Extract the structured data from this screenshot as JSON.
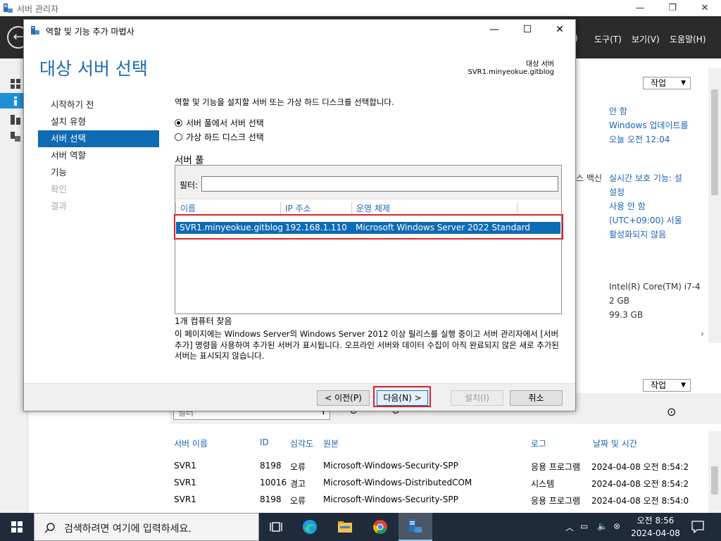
{
  "main_window": {
    "title": "서버 관리자",
    "controls": {
      "minimize": "—",
      "maximize": "❐",
      "close": "✕"
    },
    "menu": [
      {
        "id": "m1",
        "label": ")"
      },
      {
        "id": "m2",
        "label": "도구(T)"
      },
      {
        "id": "m3",
        "label": "보기(V)"
      },
      {
        "id": "m4",
        "label": "도움말(H)"
      }
    ],
    "back_glyph": "←"
  },
  "background": {
    "task_dropdown_1": "작업",
    "task_dropdown_2": "작업",
    "props": [
      "안 함",
      "Windows 업데이트를",
      "오늘 오전 12:04",
      "실시간 보호 기능: 설",
      "설정",
      "사용 안 함",
      "(UTC+09:00) 서울",
      "활성화되지 않음",
      "Intel(R) Core(TM) i7-4",
      "2 GB",
      "99.3 GB"
    ],
    "av_label": "스 백신",
    "search_fragment": "필터",
    "events": {
      "headers": [
        "서버 이름",
        "ID",
        "심각도",
        "원본",
        "로그",
        "날짜 및 시간"
      ],
      "rows": [
        [
          "SVR1",
          "8198",
          "오류",
          "Microsoft-Windows-Security-SPP",
          "응용 프로그램",
          "2024-04-08 오전 8:54:2"
        ],
        [
          "SVR1",
          "10016",
          "경고",
          "Microsoft-Windows-DistributedCOM",
          "시스템",
          "2024-04-08 오전 8:54:2"
        ],
        [
          "SVR1",
          "8198",
          "오류",
          "Microsoft-Windows-Security-SPP",
          "응용 프로그램",
          "2024-04-08 오전 8:54:0"
        ]
      ]
    }
  },
  "wizard": {
    "title": "역할 및 기능 추가 마법사",
    "controls": {
      "minimize": "—",
      "maximize": "☐",
      "close": "✕"
    },
    "header": "대상 서버 선택",
    "destination_label": "대상 서버",
    "destination_value": "SVR1.minyeokue.gitblog",
    "nav": [
      {
        "label": "시작하기 전",
        "state": "normal"
      },
      {
        "label": "설치 유형",
        "state": "normal"
      },
      {
        "label": "서버 선택",
        "state": "active"
      },
      {
        "label": "서버 역할",
        "state": "normal"
      },
      {
        "label": "기능",
        "state": "normal"
      },
      {
        "label": "확인",
        "state": "disabled"
      },
      {
        "label": "결과",
        "state": "disabled"
      }
    ],
    "instruction": "역할 및 기능을 설치할 서버 또는 가상 하드 디스크를 선택합니다.",
    "radio_pool": "서버 풀에서 서버 선택",
    "radio_vhd": "가상 하드 디스크 선택",
    "pool_label": "서버 풀",
    "filter_label": "필터:",
    "filter_value": "",
    "columns": {
      "name": "이름",
      "ip": "IP 주소",
      "os": "운영 체제"
    },
    "selected_row": {
      "name": "SVR1.minyeokue.gitblog",
      "ip": "192.168.1.110",
      "os": "Microsoft Windows Server 2022 Standard"
    },
    "found": "1개 컴퓨터 찾음",
    "description": "이 페이지에는 Windows Server의 Windows Server 2012 이상 릴리스를 실행 중이고 서버 관리자에서 [서버 추가] 명령을 사용하여 추가된 서버가 표시됩니다. 오프라인 서버와 데이터 수집이 아직 완료되지 않은 새로 추가된 서버는 표시되지 않습니다.",
    "buttons": {
      "prev": "< 이전(P)",
      "next": "다음(N) >",
      "install": "설치(I)",
      "cancel": "취소"
    }
  },
  "taskbar": {
    "search_placeholder": "검색하려면 여기에 입력하세요.",
    "time": "오전 8:56",
    "date": "2024-04-08"
  },
  "colors": {
    "accent": "#0f6ab4",
    "header_blue": "#2069b3",
    "highlight_red": "#d8242b",
    "taskbar": "#1f2a3a",
    "banner": "#2b2b2b"
  }
}
